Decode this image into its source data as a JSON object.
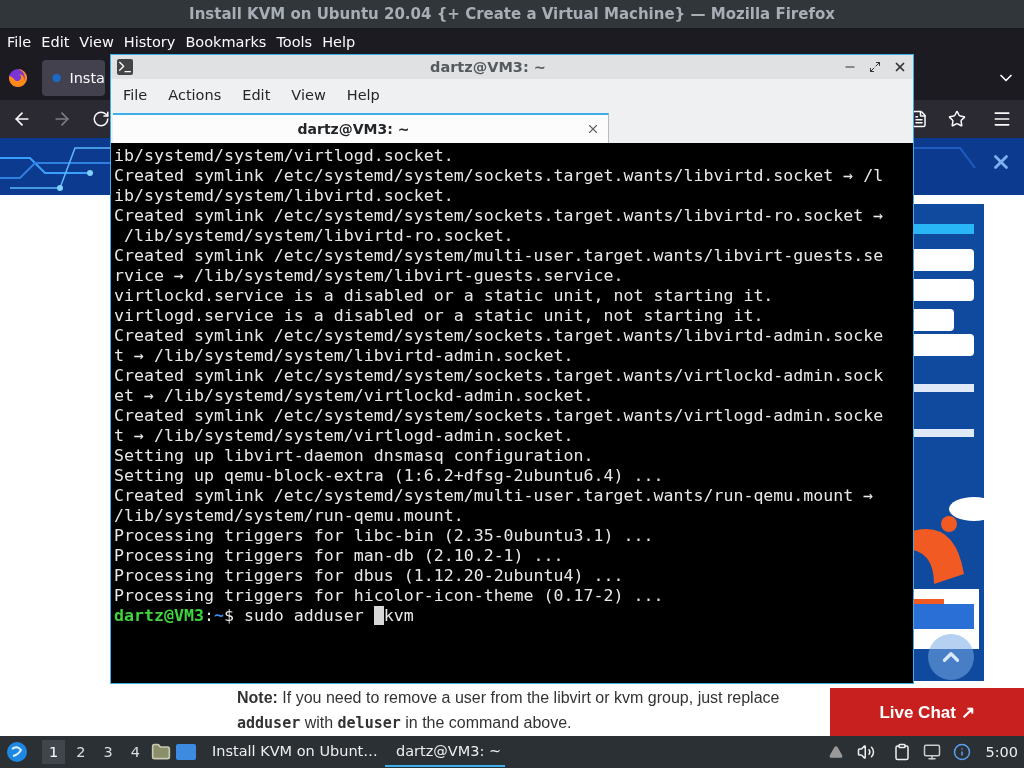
{
  "browser": {
    "title": "Install KVM on Ubuntu 20.04 {+ Create a Virtual Machine} — Mozilla Firefox",
    "menu": [
      "File",
      "Edit",
      "View",
      "History",
      "Bookmarks",
      "Tools",
      "Help"
    ],
    "tab": {
      "label": "Insta",
      "selected": true
    },
    "page": {
      "note": [
        {
          "kind": "bold",
          "text": "Note:"
        },
        {
          "kind": "plain",
          "text": " If you need to remove a user from the libvirt or kvm group, just replace "
        },
        {
          "kind": "code",
          "text": "adduser"
        },
        {
          "kind": "plain",
          "text": " with "
        },
        {
          "kind": "code",
          "text": "deluser"
        },
        {
          "kind": "plain",
          "text": " in the command above."
        }
      ],
      "live_chat": "Live Chat ↗"
    }
  },
  "terminal": {
    "title": "dartz@VM3: ~",
    "menu": [
      "File",
      "Actions",
      "Edit",
      "View",
      "Help"
    ],
    "tab": {
      "label": "dartz@VM3: ~",
      "selected": true
    },
    "lines": [
      "ib/systemd/system/virtlogd.socket.",
      "Created symlink /etc/systemd/system/sockets.target.wants/libvirtd.socket → /l",
      "ib/systemd/system/libvirtd.socket.",
      "Created symlink /etc/systemd/system/sockets.target.wants/libvirtd-ro.socket →",
      " /lib/systemd/system/libvirtd-ro.socket.",
      "Created symlink /etc/systemd/system/multi-user.target.wants/libvirt-guests.se",
      "rvice → /lib/systemd/system/libvirt-guests.service.",
      "virtlockd.service is a disabled or a static unit, not starting it.",
      "virtlogd.service is a disabled or a static unit, not starting it.",
      "Created symlink /etc/systemd/system/sockets.target.wants/libvirtd-admin.socke",
      "t → /lib/systemd/system/libvirtd-admin.socket.",
      "Created symlink /etc/systemd/system/sockets.target.wants/virtlockd-admin.sock",
      "et → /lib/systemd/system/virtlockd-admin.socket.",
      "Created symlink /etc/systemd/system/sockets.target.wants/virtlogd-admin.socke",
      "t → /lib/systemd/system/virtlogd-admin.socket.",
      "Setting up libvirt-daemon dnsmasq configuration.",
      "Setting up qemu-block-extra (1:6.2+dfsg-2ubuntu6.4) ...",
      "Created symlink /etc/systemd/system/multi-user.target.wants/run-qemu.mount →",
      "/lib/systemd/system/run-qemu.mount.",
      "Processing triggers for libc-bin (2.35-0ubuntu3.1) ...",
      "Processing triggers for man-db (2.10.2-1) ...",
      "Processing triggers for dbus (1.12.20-2ubuntu4) ...",
      "Processing triggers for hicolor-icon-theme (0.17-2) ..."
    ],
    "prompt": {
      "user_host": "dartz@VM3",
      "separator": ":",
      "path": "~",
      "symbol": "$",
      "before_cursor": " sudo adduser ",
      "after_cursor": "kvm"
    }
  },
  "taskbar": {
    "workspaces": [
      {
        "label": "1",
        "selected": true
      },
      {
        "label": "2",
        "selected": false
      },
      {
        "label": "3",
        "selected": false
      },
      {
        "label": "4",
        "selected": false
      }
    ],
    "tasks": [
      {
        "kind": "browser",
        "label": "Install KVM on Ubunt…",
        "selected": false
      },
      {
        "kind": "terminal",
        "label": "dartz@VM3: ~",
        "selected": true
      }
    ],
    "clock": "5:00"
  }
}
